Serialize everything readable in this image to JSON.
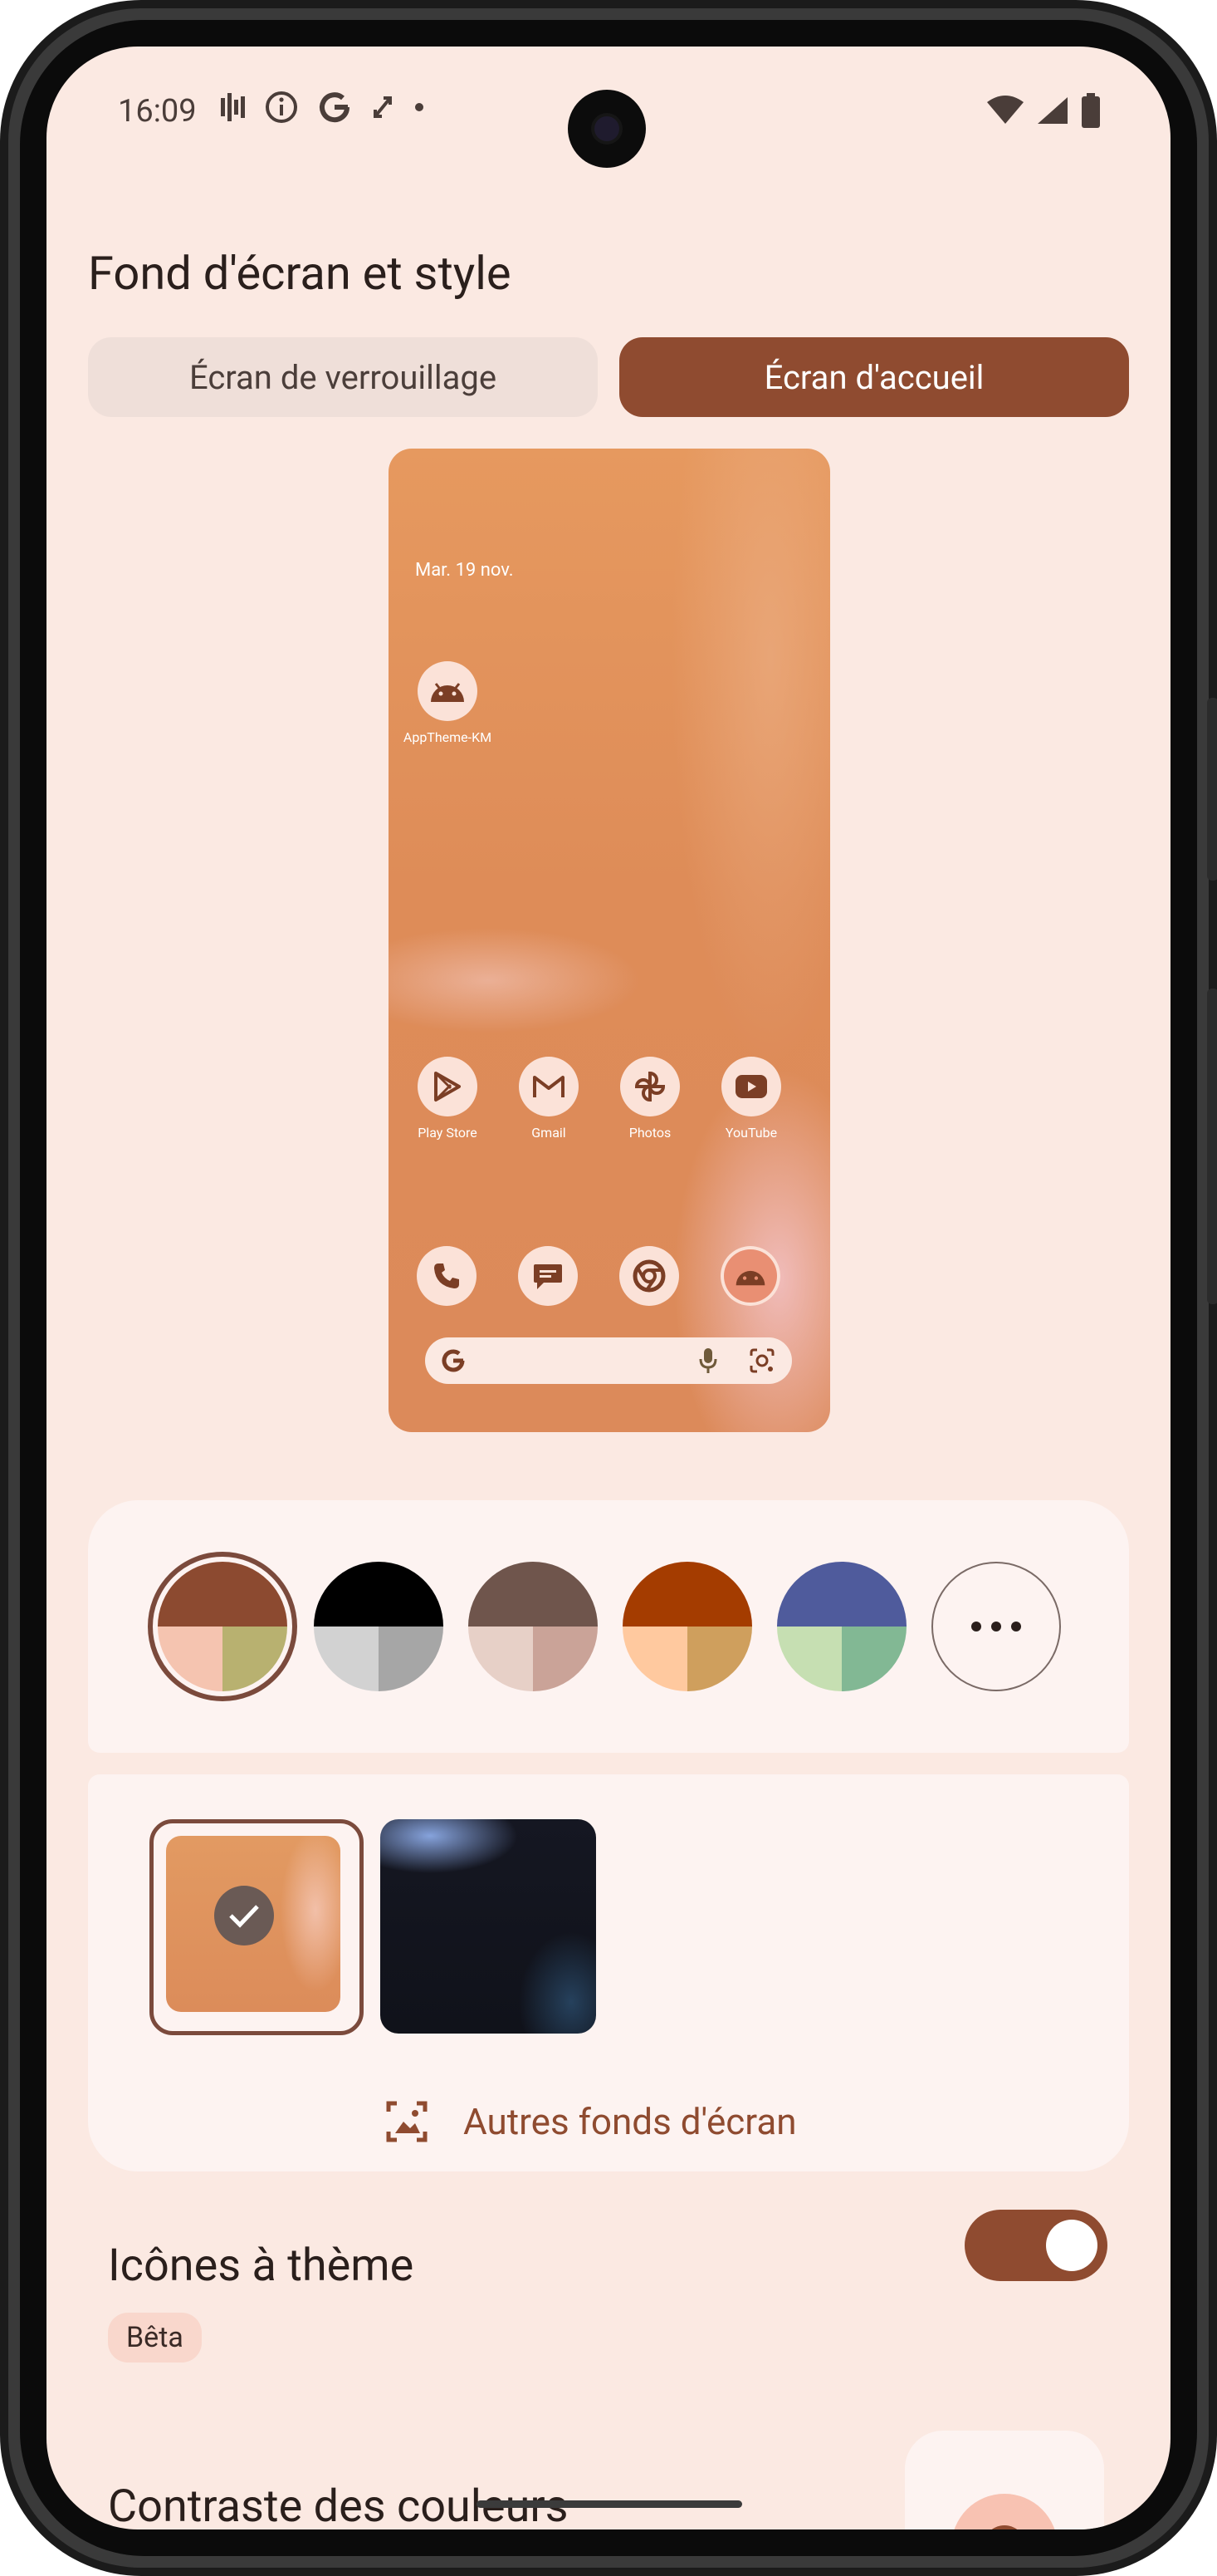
{
  "status_bar": {
    "time": "16:09",
    "left_icons": [
      "signal-bars-icon",
      "info-icon",
      "google-icon",
      "sync-icon",
      "dot-icon"
    ],
    "right_icons": [
      "wifi-icon",
      "cell-signal-icon",
      "battery-icon"
    ]
  },
  "page": {
    "title": "Fond d'écran et style"
  },
  "tabs": [
    {
      "label": "Écran de verrouillage",
      "selected": false
    },
    {
      "label": "Écran d'accueil",
      "selected": true
    }
  ],
  "preview": {
    "date": "Mar. 19 nov.",
    "top_app": {
      "label": "AppTheme-KM",
      "icon": "android-icon"
    },
    "apps": [
      {
        "label": "Play Store",
        "icon": "play-store-icon"
      },
      {
        "label": "Gmail",
        "icon": "gmail-icon"
      },
      {
        "label": "Photos",
        "icon": "photos-icon"
      },
      {
        "label": "YouTube",
        "icon": "youtube-icon"
      }
    ],
    "dock": [
      {
        "icon": "phone-icon"
      },
      {
        "icon": "messages-icon"
      },
      {
        "icon": "chrome-icon"
      },
      {
        "icon": "android-icon"
      }
    ],
    "search": {
      "icons": [
        "google-g-icon",
        "mic-icon",
        "lens-icon"
      ]
    }
  },
  "palettes": [
    {
      "top": "#8c4a30",
      "bl": "#f5c4b0",
      "br": "#b8b170",
      "selected": true
    },
    {
      "top": "#000000",
      "bl": "#d2d2d2",
      "br": "#a6a6a6",
      "selected": false
    },
    {
      "top": "#6f554c",
      "bl": "#e7d0c7",
      "br": "#caa398",
      "selected": false
    },
    {
      "top": "#a43c00",
      "bl": "#ffc99f",
      "br": "#cf9f5d",
      "selected": false
    },
    {
      "top": "#4f5b9c",
      "bl": "#c6dfb2",
      "br": "#82b894",
      "selected": false
    }
  ],
  "palette_more_icon": "more-horiz-icon",
  "wallpapers": {
    "more_label": "Autres fonds d'écran"
  },
  "themed_icons": {
    "label": "Icônes à thème",
    "badge": "Bêta",
    "enabled": true
  },
  "contrast": {
    "label": "Contraste des couleurs"
  }
}
